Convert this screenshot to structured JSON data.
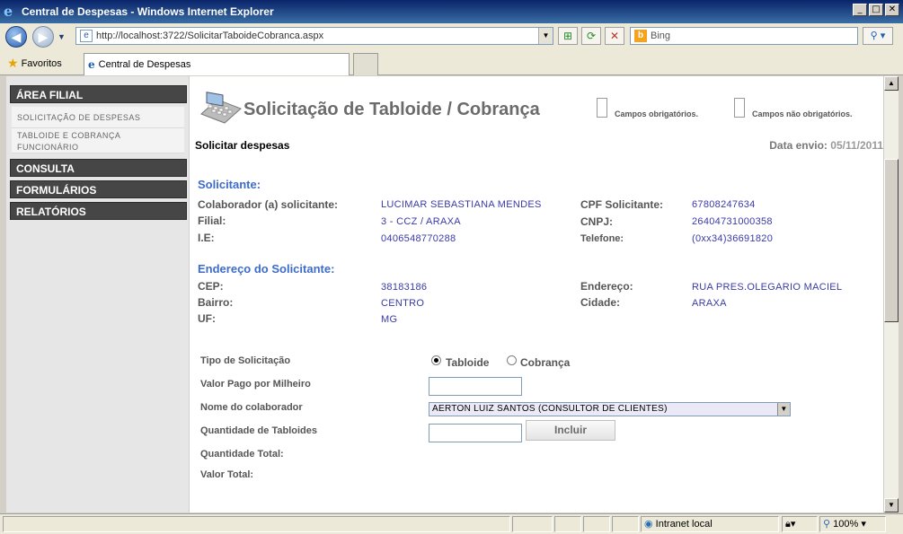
{
  "window": {
    "title": "Central de Despesas - Windows Internet Explorer"
  },
  "addressbar": {
    "url": "http://localhost:3722/SolicitarTaboideCobranca.aspx",
    "search_placeholder": "Bing"
  },
  "favorites": {
    "label": "Favoritos",
    "tab_title": "Central de Despesas"
  },
  "sidebar": {
    "sections": [
      {
        "label": "ÁREA FILIAL"
      },
      {
        "label": "CONSULTA"
      },
      {
        "label": "FORMULÁRIOS"
      },
      {
        "label": "RELATÓRIOS"
      }
    ],
    "items": [
      {
        "label": "SOLICITAÇÃO DE DESPESAS"
      },
      {
        "label": "TABLOIDE E COBRANÇA FUNCIONÁRIO"
      }
    ]
  },
  "page": {
    "title": "Solicitação de Tabloide / Cobrança",
    "legend_required": "Campos obrigatórios.",
    "legend_optional": "Campos não obrigatórios.",
    "subtitle": "Solicitar despesas",
    "date_label": "Data envio:",
    "date_value": "05/11/2011"
  },
  "solicitante": {
    "heading": "Solicitante:",
    "colaborador_label": "Colaborador (a) solicitante:",
    "colaborador_value": "LUCIMAR SEBASTIANA MENDES",
    "filial_label": "Filial:",
    "filial_value": "3 - CCZ / ARAXA",
    "ie_label": "I.E:",
    "ie_value": "0406548770288",
    "cpf_label": "CPF Solicitante:",
    "cpf_value": "67808247634",
    "cnpj_label": "CNPJ:",
    "cnpj_value": "26404731000358",
    "telefone_label": "Telefone:",
    "telefone_value": "(0xx34)36691820"
  },
  "endereco": {
    "heading": "Endereço do Solicitante:",
    "cep_label": "CEP:",
    "cep_value": "38183186",
    "bairro_label": "Bairro:",
    "bairro_value": "CENTRO",
    "uf_label": "UF:",
    "uf_value": "MG",
    "endereco_label": "Endereço:",
    "endereco_value": "RUA PRES.OLEGARIO MACIEL",
    "cidade_label": "Cidade:",
    "cidade_value": "ARAXA"
  },
  "form": {
    "tipo_label": "Tipo de Solicitação",
    "option_tabloide": "Tabloide",
    "option_cobranca": "Cobrança",
    "selected_tipo": "Tabloide",
    "valor_milheiro_label": "Valor Pago por Milheiro",
    "valor_milheiro_value": "",
    "colaborador_label": "Nome do colaborador",
    "colaborador_selected": "AERTON LUIZ SANTOS (CONSULTOR DE CLIENTES)",
    "quantidade_label": "Quantidade de Tabloides",
    "quantidade_value": "",
    "incluir_button": "Incluir",
    "quantidade_total_label": "Quantidade Total:",
    "valor_total_label": "Valor Total:"
  },
  "statusbar": {
    "zone": "Intranet local",
    "zoom": "100%"
  },
  "colors": {
    "section_heading": "#3d6ccc",
    "value_text": "#3a3aa8",
    "sidebar_header": "#464646"
  }
}
